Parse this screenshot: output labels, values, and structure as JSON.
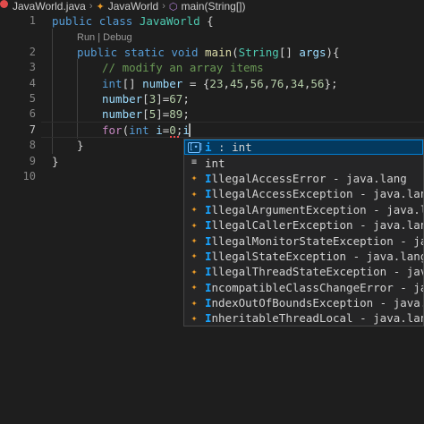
{
  "breadcrumb": {
    "file": "JavaWorld.java",
    "class": "JavaWorld",
    "method": "main(String[])"
  },
  "codelens": "Run | Debug",
  "line_numbers": [
    "1",
    "2",
    "3",
    "4",
    "5",
    "6",
    "7",
    "8",
    "9",
    "10"
  ],
  "active_line": "7",
  "code": {
    "l1": {
      "kw": "public",
      "kw2": "class",
      "name": "JavaWorld",
      "brace": " {"
    },
    "l2": {
      "kw": "public",
      "kw2": "static",
      "kw3": "void",
      "fn": "main",
      "p1": "(",
      "ty": "String",
      "p2": "[] ",
      "arg": "args",
      "p3": "){"
    },
    "l3": {
      "comment": "// modify an array items"
    },
    "l4": {
      "ty": "int",
      "p1": "[] ",
      "var": "number",
      "p2": " = {",
      "n1": "23",
      "n2": "45",
      "n3": "56",
      "n4": "76",
      "n5": "34",
      "n6": "56",
      "p3": "};"
    },
    "l5": {
      "var": "number",
      "p1": "[",
      "idx": "3",
      "p2": "]=",
      "val": "67",
      "p3": ";"
    },
    "l6": {
      "var": "number",
      "p1": "[",
      "idx": "5",
      "p2": "]=",
      "val": "89",
      "p3": ";"
    },
    "l7": {
      "ctl": "for",
      "p1": "(",
      "ty": "int",
      "var": "i",
      "p2": "=",
      "n": "0",
      "p3": ";",
      "var2": "i"
    },
    "l8": {
      "brace": "}"
    },
    "l9": {
      "brace": "}"
    }
  },
  "suggestions": [
    {
      "icon": "variable-icon",
      "prefix": "i",
      "rest": " : int",
      "selected": true
    },
    {
      "icon": "keyword-icon",
      "prefix": "",
      "rest": "int",
      "selected": false
    },
    {
      "icon": "class-icon",
      "prefix": "I",
      "rest": "llegalAccessError - java.lang"
    },
    {
      "icon": "class-icon",
      "prefix": "I",
      "rest": "llegalAccessException - java.lang"
    },
    {
      "icon": "class-icon",
      "prefix": "I",
      "rest": "llegalArgumentException - java.lang"
    },
    {
      "icon": "class-icon",
      "prefix": "I",
      "rest": "llegalCallerException - java.lang"
    },
    {
      "icon": "class-icon",
      "prefix": "I",
      "rest": "llegalMonitorStateException - java.lang"
    },
    {
      "icon": "class-icon",
      "prefix": "I",
      "rest": "llegalStateException - java.lang"
    },
    {
      "icon": "class-icon",
      "prefix": "I",
      "rest": "llegalThreadStateException - java.lang"
    },
    {
      "icon": "class-icon",
      "prefix": "I",
      "rest": "ncompatibleClassChangeError - java.lang"
    },
    {
      "icon": "class-icon",
      "prefix": "I",
      "rest": "ndexOutOfBoundsException - java.lang"
    },
    {
      "icon": "class-icon",
      "prefix": "I",
      "rest": "nheritableThreadLocal - java.lang"
    }
  ]
}
